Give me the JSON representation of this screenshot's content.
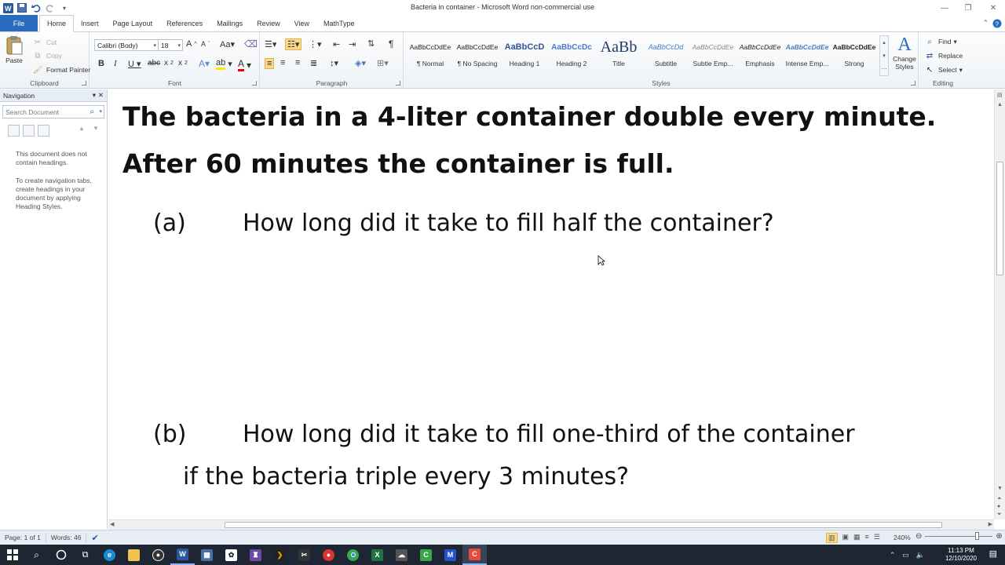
{
  "window": {
    "title": "Bacteria in container  -  Microsoft Word non-commercial use"
  },
  "tabs": [
    "File",
    "Home",
    "Insert",
    "Page Layout",
    "References",
    "Mailings",
    "Review",
    "View",
    "MathType"
  ],
  "ribbon": {
    "clipboard": {
      "label": "Clipboard",
      "paste": "Paste",
      "cut": "Cut",
      "copy": "Copy",
      "format_painter": "Format Painter"
    },
    "font": {
      "label": "Font",
      "name": "Calibri (Body)",
      "size": "18"
    },
    "paragraph": {
      "label": "Paragraph"
    },
    "styles": {
      "label": "Styles",
      "items": [
        {
          "sample": "AaBbCcDdEe",
          "name": "¶ Normal"
        },
        {
          "sample": "AaBbCcDdEe",
          "name": "¶ No Spacing"
        },
        {
          "sample": "AaBbCcD",
          "name": "Heading 1"
        },
        {
          "sample": "AaBbCcDc",
          "name": "Heading 2"
        },
        {
          "sample": "AaBb",
          "name": "Title"
        },
        {
          "sample": "AaBbCcDd",
          "name": "Subtitle"
        },
        {
          "sample": "AaBbCcDdEe",
          "name": "Subtle Emp..."
        },
        {
          "sample": "AaBbCcDdEe",
          "name": "Emphasis"
        },
        {
          "sample": "AaBbCcDdEe",
          "name": "Intense Emp..."
        },
        {
          "sample": "AaBbCcDdEe",
          "name": "Strong"
        }
      ],
      "change_styles": "Change Styles"
    },
    "editing": {
      "label": "Editing",
      "find": "Find",
      "replace": "Replace",
      "select": "Select"
    }
  },
  "navigation": {
    "title": "Navigation",
    "search_placeholder": "Search Document",
    "message1": "This document does not contain headings.",
    "message2": "To create navigation tabs, create headings in your document by applying Heading Styles."
  },
  "document": {
    "heading_line1": "The bacteria in a 4-liter container double every minute.",
    "heading_line2": "After 60 minutes the container is full.",
    "question_a_label": "(a)",
    "question_a_text": "How long did it take to fill half the container?",
    "question_b_label": "(b)",
    "question_b_text_line1": "How long did it take to fill one-third of the container",
    "question_b_text_line2": "if the bacteria triple every 3 minutes?"
  },
  "status": {
    "page": "Page: 1 of 1",
    "words": "Words: 46",
    "zoom": "240%"
  },
  "taskbar": {
    "time": "11:13 PM",
    "date": "12/10/2020"
  }
}
